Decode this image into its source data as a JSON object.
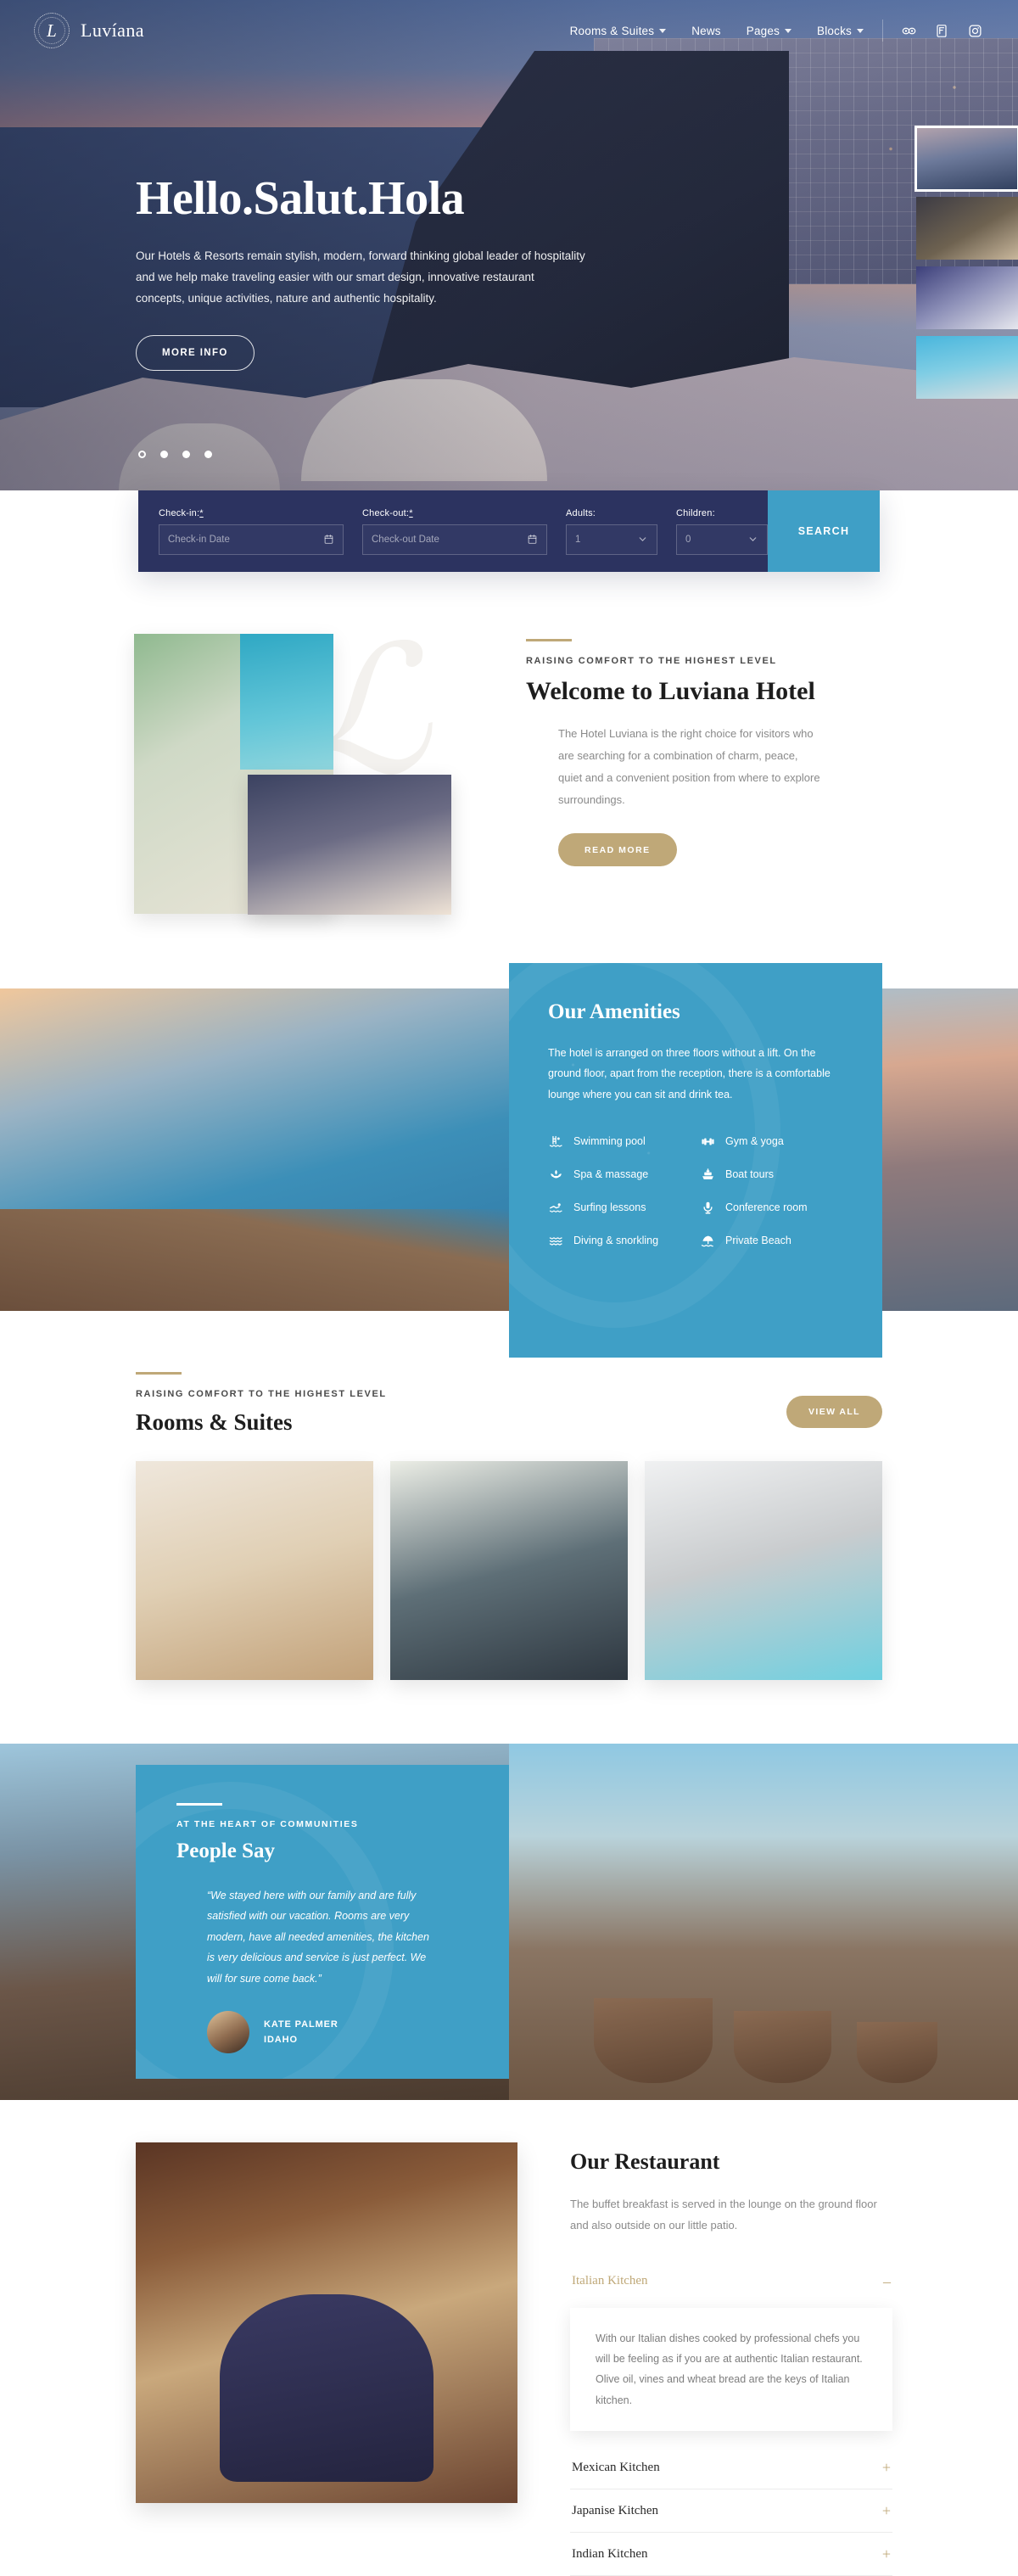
{
  "brand": {
    "name": "Luvíana",
    "monogram": "L"
  },
  "nav": {
    "items": [
      {
        "label": "Rooms & Suites",
        "has_dropdown": true
      },
      {
        "label": "News",
        "has_dropdown": false
      },
      {
        "label": "Pages",
        "has_dropdown": true
      },
      {
        "label": "Blocks",
        "has_dropdown": true
      }
    ],
    "socials": [
      {
        "name": "tripadvisor-icon"
      },
      {
        "name": "foursquare-icon"
      },
      {
        "name": "instagram-icon"
      }
    ]
  },
  "hero": {
    "title": "Hello.Salut.Hola",
    "subtitle": "Our Hotels & Resorts remain stylish, modern, forward thinking global leader of hospitality and we help make traveling easier with our smart design, innovative restaurant concepts, unique activities, nature and authentic hospitality.",
    "cta": "MORE INFO",
    "slide_count": 4,
    "active_slide": 1,
    "thumbnails": [
      {
        "name": "thumb-caldera-dusk",
        "active": true
      },
      {
        "name": "thumb-dining-wine",
        "active": false
      },
      {
        "name": "thumb-suite-bedroom",
        "active": false
      },
      {
        "name": "thumb-island-bay",
        "active": false
      }
    ]
  },
  "booking": {
    "checkin_label": "Check-in:",
    "checkin_required": "*",
    "checkin_placeholder": "Check-in Date",
    "checkout_label": "Check-out:",
    "checkout_required": "*",
    "checkout_placeholder": "Check-out Date",
    "adults_label": "Adults:",
    "adults_value": "1",
    "children_label": "Children:",
    "children_value": "0",
    "search_label": "SEARCH",
    "accent_color": "#3f9fc6",
    "panel_color": "#2c3360"
  },
  "welcome": {
    "eyebrow": "RAISING COMFORT TO THE HIGHEST LEVEL",
    "heading": "Welcome to Luviana Hotel",
    "body": "The Hotel Luviana is the right choice for visitors who are searching for a combination of charm, peace, quiet and a convenient position from where to explore surroundings.",
    "cta": "READ MORE",
    "gold": "#bfa878"
  },
  "amenities": {
    "heading": "Our Amenities",
    "body": "The hotel is arranged on three floors without a lift. On the ground floor, apart from the reception, there is a comfortable lounge where you can sit and drink tea.",
    "panel_color": "#3f9fc6",
    "items": [
      {
        "label": "Swimming pool",
        "icon": "pool-ladder-icon"
      },
      {
        "label": "Gym & yoga",
        "icon": "dumbbell-icon"
      },
      {
        "label": "Spa & massage",
        "icon": "lotus-icon"
      },
      {
        "label": "Boat tours",
        "icon": "boat-icon"
      },
      {
        "label": "Surfing lessons",
        "icon": "swimmer-icon"
      },
      {
        "label": "Conference room",
        "icon": "microphone-icon"
      },
      {
        "label": "Diving & snorkling",
        "icon": "waves-icon"
      },
      {
        "label": "Private Beach",
        "icon": "beach-umbrella-icon"
      }
    ]
  },
  "rooms": {
    "eyebrow": "RAISING COMFORT TO THE HIGHEST LEVEL",
    "heading": "Rooms & Suites",
    "cta": "VIEW ALL",
    "cards": [
      {
        "name": "room-card-double"
      },
      {
        "name": "room-card-twin"
      },
      {
        "name": "room-card-suite"
      }
    ]
  },
  "testimonial": {
    "eyebrow": "AT THE HEART OF COMMUNITIES",
    "heading": "People Say",
    "quote": "“We stayed here with our family and are fully satisfied with our vacation. Rooms are very modern, have all needed amenities, the kitchen is very delicious and service is just perfect. We will for sure come back.”",
    "author": "KATE PALMER",
    "location": "IDAHO",
    "panel_color": "#3f9fc6"
  },
  "restaurant": {
    "heading": "Our Restaurant",
    "body": "The buffet breakfast is served in the lounge on the ground floor and also outside on our little patio.",
    "accordion": [
      {
        "title": "Italian Kitchen",
        "open": true,
        "sign": "–",
        "body": "With our Italian dishes cooked by professional chefs you will be feeling as if you are at authentic Italian restaurant. Olive oil, vines and wheat bread are the keys of Italian kitchen."
      },
      {
        "title": "Mexican Kitchen",
        "open": false,
        "sign": "+",
        "body": ""
      },
      {
        "title": "Japanise Kitchen",
        "open": false,
        "sign": "+",
        "body": ""
      },
      {
        "title": "Indian Kitchen",
        "open": false,
        "sign": "+",
        "body": ""
      }
    ]
  }
}
